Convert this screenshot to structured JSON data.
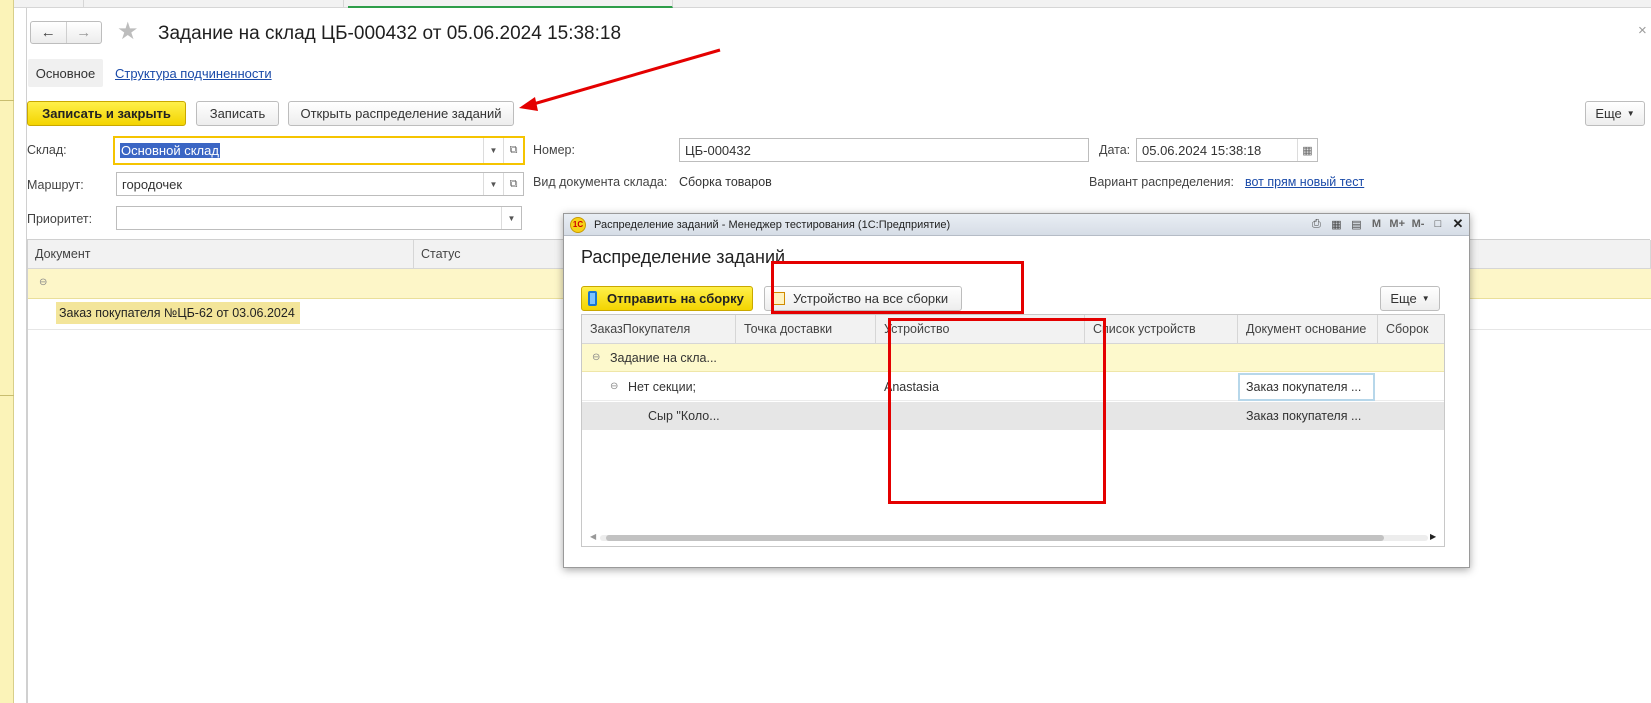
{
  "window": {
    "title": "Задание на склад ЦБ-000432 от 05.06.2024 15:38:18",
    "back_label": "←",
    "forward_label": "→",
    "close_label": "×"
  },
  "sections": {
    "active": "Основное",
    "link": "Структура подчиненности"
  },
  "toolbar": {
    "save_close": "Записать и закрыть",
    "save": "Записать",
    "open_distribution": "Открыть распределение заданий",
    "more": "Еще"
  },
  "form": {
    "warehouse_label": "Склад:",
    "warehouse_value": "Основной склад",
    "route_label": "Маршрут:",
    "route_value": "городочек",
    "priority_label": "Приоритет:",
    "priority_value": "",
    "number_label": "Номер:",
    "number_value": "ЦБ-000432",
    "date_label": "Дата:",
    "date_value": "05.06.2024 15:38:18",
    "doc_type_label": "Вид документа склада:",
    "doc_type_value": "Сборка товаров",
    "variant_label": "Вариант распределения:",
    "variant_value": "вот прям новый тест"
  },
  "main_table": {
    "columns": [
      "Документ",
      "Статус"
    ],
    "rows": [
      {
        "document": "Заказ покупателя №ЦБ-62 от 03.06.2024",
        "status": ""
      }
    ]
  },
  "modal": {
    "window_title": "Распределение заданий  - Менеджер тестирования (1С:Предприятие)",
    "titlebar_icons": [
      "print-icon",
      "calendar-grid-icon",
      "calendar-31-icon",
      "M",
      "M+",
      "M-",
      "maximize-icon",
      "close-icon"
    ],
    "heading": "Распределение заданий",
    "send_button": "Отправить на сборку",
    "device_button": "Устройство на все сборки",
    "more": "Еще",
    "columns": [
      "ЗаказПокупателя",
      "Точка доставки",
      "Устройство",
      "Список устройств",
      "Документ основание",
      "Сборок"
    ],
    "rows": [
      {
        "order": "Задание на скла...",
        "point": "",
        "device": "",
        "devices": "",
        "basis": "",
        "count": ""
      },
      {
        "order": "Нет секции;",
        "point": "",
        "device": "Anastasia",
        "devices": "",
        "basis": "Заказ покупателя ...",
        "count": ""
      },
      {
        "order": "Сыр \"Коло...",
        "point": "",
        "device": "",
        "devices": "",
        "basis": "Заказ покупателя ...",
        "count": ""
      }
    ]
  },
  "colors": {
    "accent_yellow": "#f3d400",
    "highlight_row": "#fdf6c8",
    "annotation_red": "#e40000",
    "link_blue": "#1a4aa8"
  }
}
